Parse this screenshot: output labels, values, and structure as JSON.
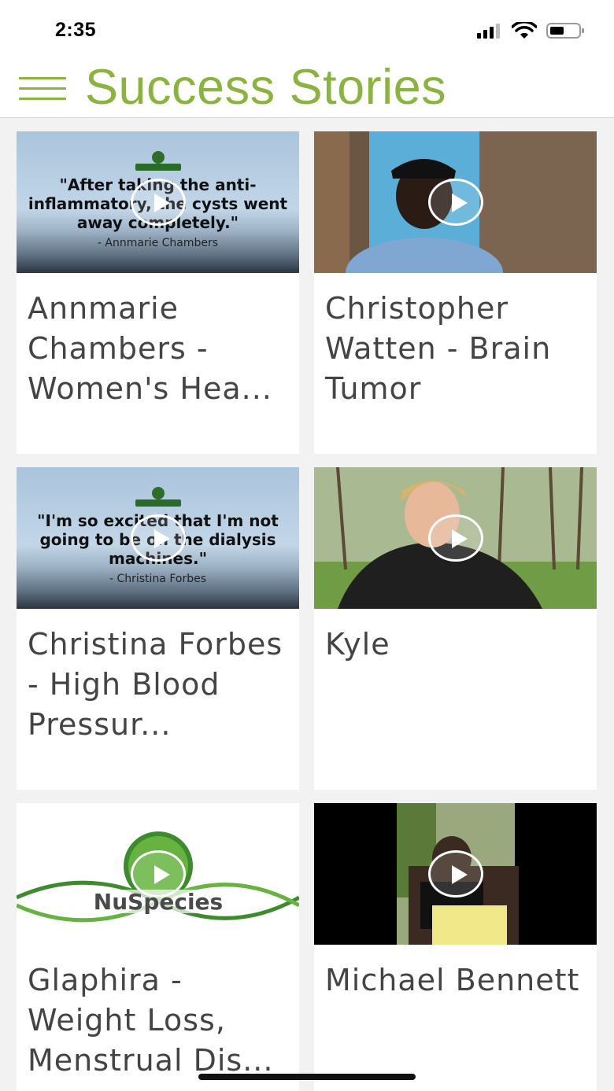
{
  "status": {
    "time": "2:35"
  },
  "header": {
    "title": "Success Stories"
  },
  "cards": [
    {
      "title": "Annmarie Chambers - Women's Hea...",
      "thumb_type": "quote",
      "quote": "\"After taking the anti-inflammatory, the cysts went away completely.\"",
      "author": "- Annmarie Chambers"
    },
    {
      "title": "Christopher Watten - Brain Tumor",
      "thumb_type": "video"
    },
    {
      "title": "Christina Forbes - High Blood Pressur...",
      "thumb_type": "quote",
      "quote": "\"I'm so excited that I'm not going to be on the dialysis machines.\"",
      "author": "- Christina Forbes"
    },
    {
      "title": "Kyle",
      "thumb_type": "video"
    },
    {
      "title": "Glaphira - Weight Loss, Menstrual Dis...",
      "thumb_type": "logo",
      "logo_text": "NuSpecies"
    },
    {
      "title": "Michael Bennett",
      "thumb_type": "video"
    }
  ],
  "colors": {
    "accent": "#8ab43f",
    "card_bg": "#ffffff",
    "page_bg": "#f2f2f3",
    "title_text": "#444444"
  },
  "icons": [
    "menu-icon",
    "signal-icon",
    "wifi-icon",
    "battery-icon",
    "play-icon"
  ]
}
